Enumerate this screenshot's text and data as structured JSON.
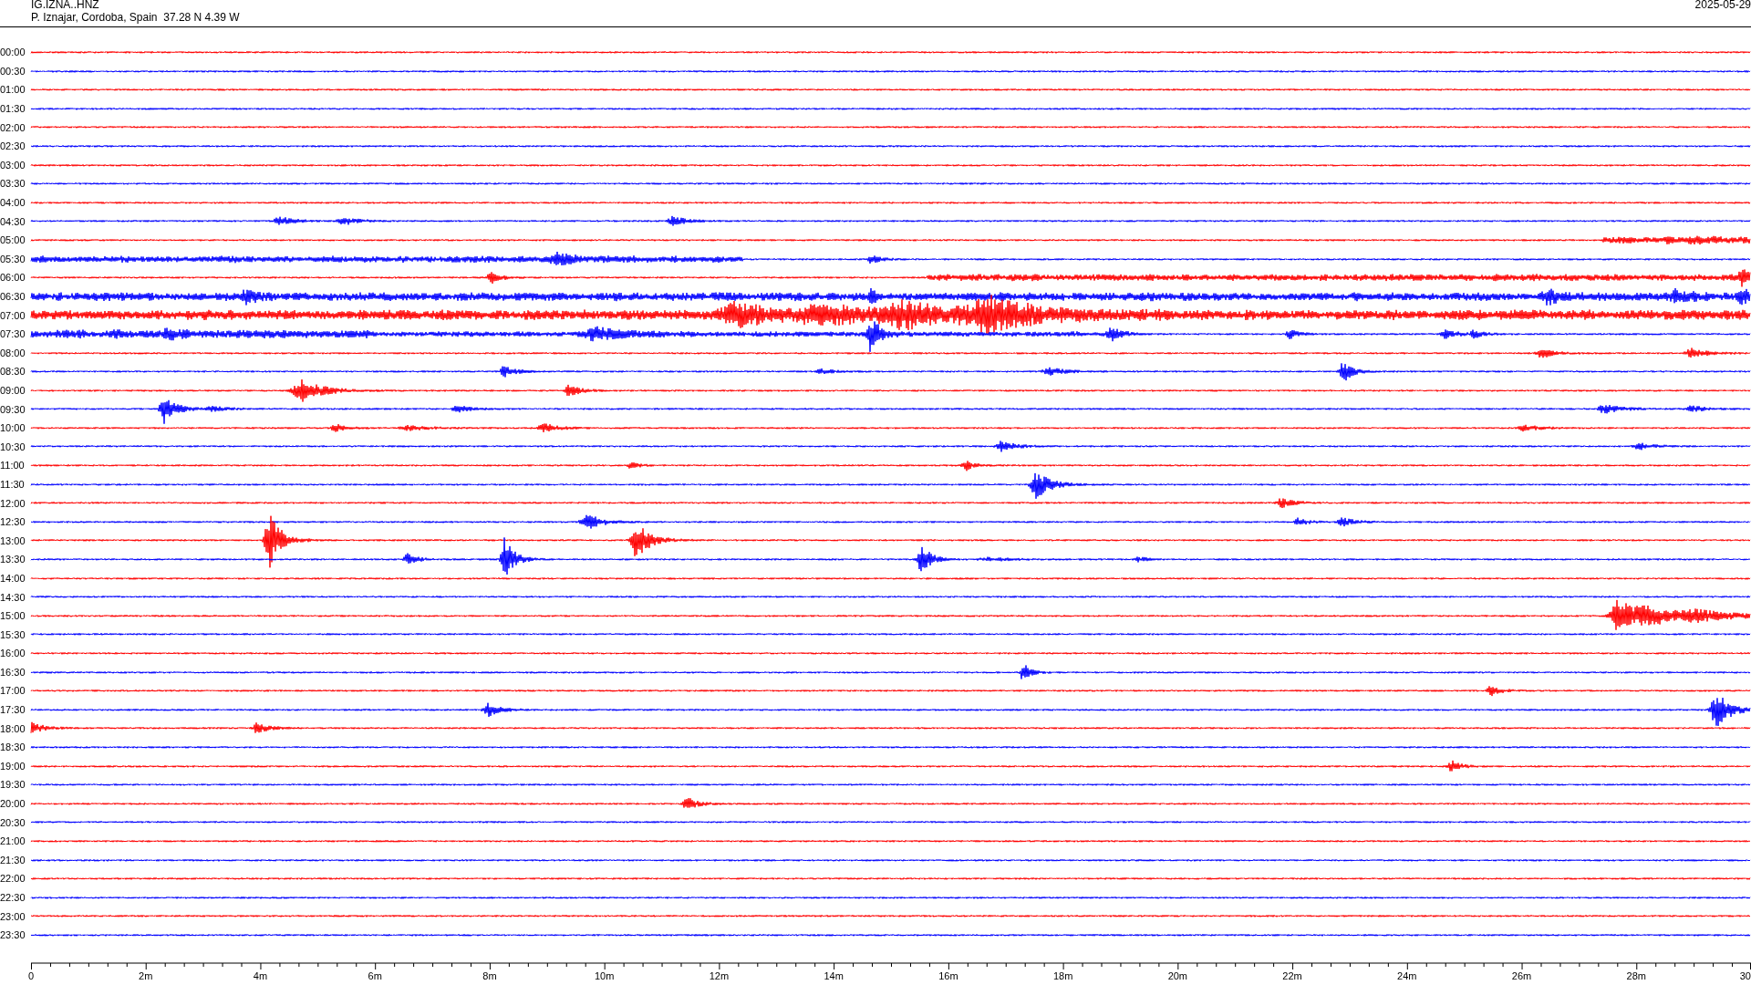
{
  "header": {
    "station": "IG.IZNA..HNZ",
    "location": "P. Iznajar, Cordoba, Spain  37.28 N 4.39 W",
    "date": "2025-05-29"
  },
  "rows": [
    {
      "time": "00:00",
      "color": "#ff0000"
    },
    {
      "time": "00:30",
      "color": "#0000ff"
    },
    {
      "time": "01:00",
      "color": "#ff0000"
    },
    {
      "time": "01:30",
      "color": "#0000ff"
    },
    {
      "time": "02:00",
      "color": "#ff0000"
    },
    {
      "time": "02:30",
      "color": "#0000ff"
    },
    {
      "time": "03:00",
      "color": "#ff0000"
    },
    {
      "time": "03:30",
      "color": "#0000ff"
    },
    {
      "time": "04:00",
      "color": "#ff0000"
    },
    {
      "time": "04:30",
      "color": "#0000ff"
    },
    {
      "time": "05:00",
      "color": "#ff0000"
    },
    {
      "time": "05:30",
      "color": "#0000ff"
    },
    {
      "time": "06:00",
      "color": "#ff0000"
    },
    {
      "time": "06:30",
      "color": "#0000ff"
    },
    {
      "time": "07:00",
      "color": "#ff0000"
    },
    {
      "time": "07:30",
      "color": "#0000ff"
    },
    {
      "time": "08:00",
      "color": "#ff0000"
    },
    {
      "time": "08:30",
      "color": "#0000ff"
    },
    {
      "time": "09:00",
      "color": "#ff0000"
    },
    {
      "time": "09:30",
      "color": "#0000ff"
    },
    {
      "time": "10:00",
      "color": "#ff0000"
    },
    {
      "time": "10:30",
      "color": "#0000ff"
    },
    {
      "time": "11:00",
      "color": "#ff0000"
    },
    {
      "time": "11:30",
      "color": "#0000ff"
    },
    {
      "time": "12:00",
      "color": "#ff0000"
    },
    {
      "time": "12:30",
      "color": "#0000ff"
    },
    {
      "time": "13:00",
      "color": "#ff0000"
    },
    {
      "time": "13:30",
      "color": "#0000ff"
    },
    {
      "time": "14:00",
      "color": "#ff0000"
    },
    {
      "time": "14:30",
      "color": "#0000ff"
    },
    {
      "time": "15:00",
      "color": "#ff0000"
    },
    {
      "time": "15:30",
      "color": "#0000ff"
    },
    {
      "time": "16:00",
      "color": "#ff0000"
    },
    {
      "time": "16:30",
      "color": "#0000ff"
    },
    {
      "time": "17:00",
      "color": "#ff0000"
    },
    {
      "time": "17:30",
      "color": "#0000ff"
    },
    {
      "time": "18:00",
      "color": "#ff0000"
    },
    {
      "time": "18:30",
      "color": "#0000ff"
    },
    {
      "time": "19:00",
      "color": "#ff0000"
    },
    {
      "time": "19:30",
      "color": "#0000ff"
    },
    {
      "time": "20:00",
      "color": "#ff0000"
    },
    {
      "time": "20:30",
      "color": "#0000ff"
    },
    {
      "time": "21:00",
      "color": "#ff0000"
    },
    {
      "time": "21:30",
      "color": "#0000ff"
    },
    {
      "time": "22:00",
      "color": "#ff0000"
    },
    {
      "time": "22:30",
      "color": "#0000ff"
    },
    {
      "time": "23:00",
      "color": "#ff0000"
    },
    {
      "time": "23:30",
      "color": "#0000ff"
    }
  ],
  "axis": {
    "labels": [
      "0",
      "2m",
      "4m",
      "6m",
      "8m",
      "10m",
      "12m",
      "14m",
      "16m",
      "18m",
      "20m",
      "22m",
      "24m",
      "26m",
      "28m",
      "30"
    ]
  }
}
